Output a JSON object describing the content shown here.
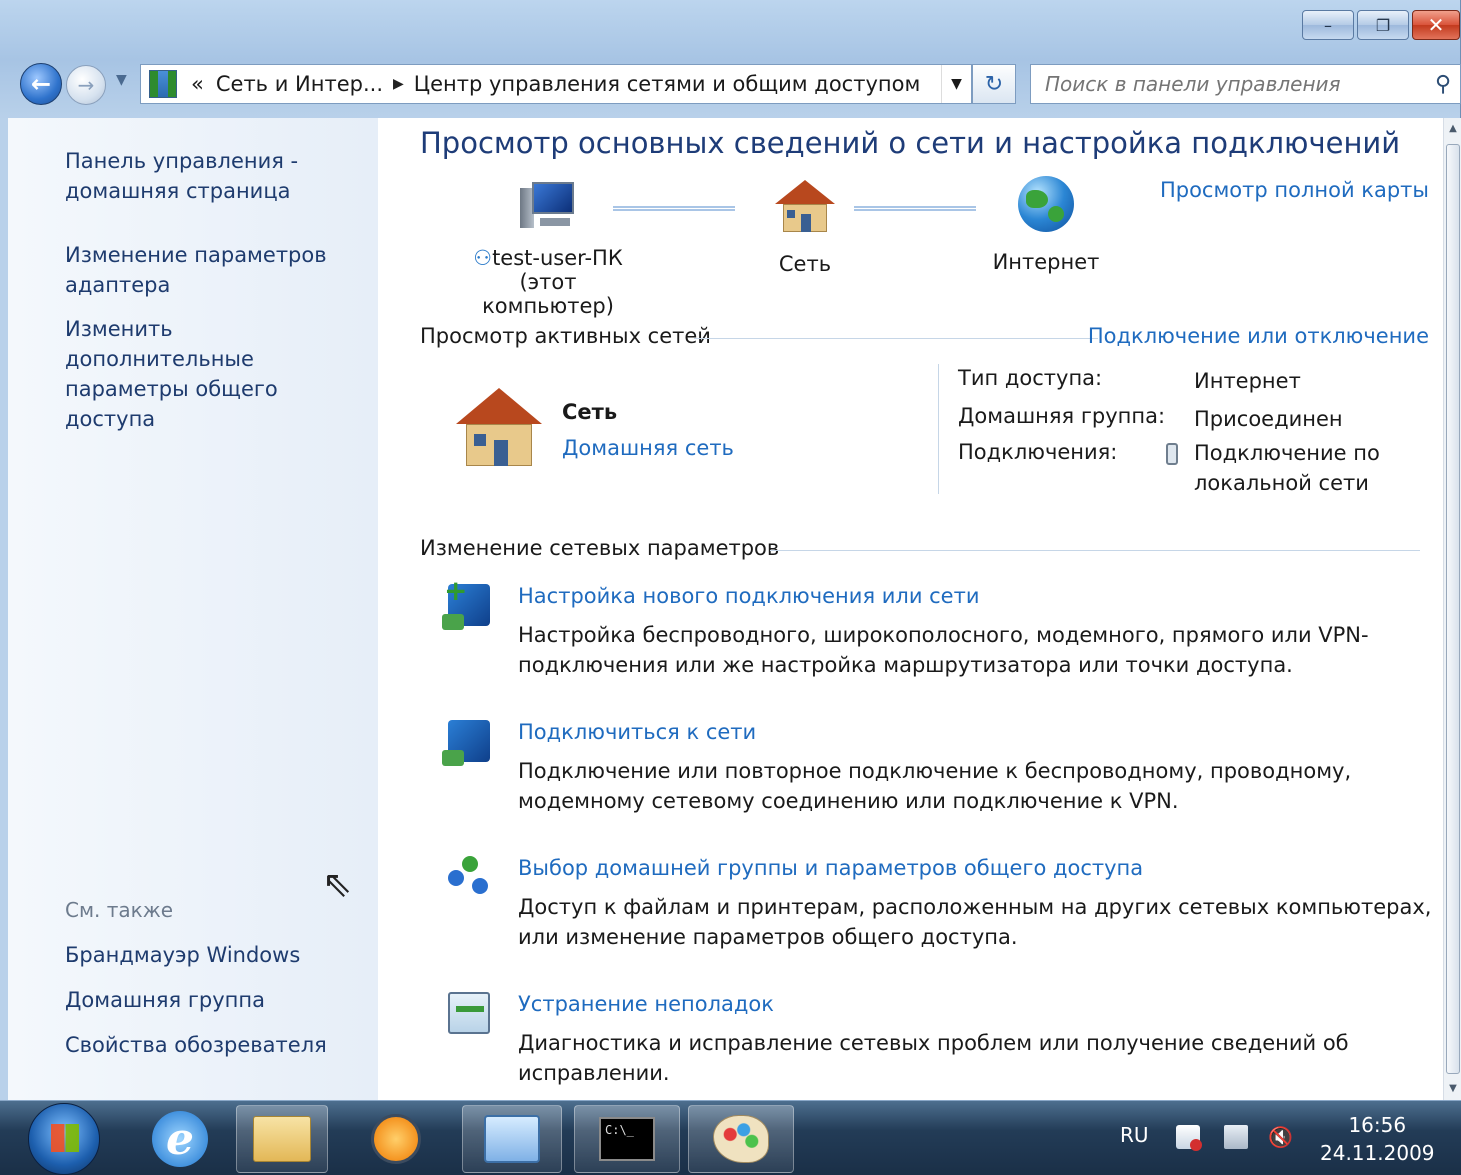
{
  "window": {
    "controls": {
      "minimize": "–",
      "maximize": "❐",
      "close": "✕"
    }
  },
  "nav": {
    "address": {
      "prefix": "«",
      "segment1": "Сеть и Интер...",
      "separator": "▶",
      "segment2": "Центр управления сетями и общим доступом",
      "dropdown": "▼"
    },
    "refresh": "↻",
    "search_placeholder": "Поиск в панели управления",
    "search_icon": "⚲"
  },
  "sidebar": {
    "links": [
      "Панель управления - домашняя страница",
      "Изменение параметров адаптера",
      "Изменить дополнительные параметры общего доступа"
    ],
    "see_also_title": "См. также",
    "see_also": [
      "Брандмауэр Windows",
      "Домашняя группа",
      "Свойства обозревателя"
    ]
  },
  "main": {
    "title": "Просмотр основных сведений о сети и настройка подключений",
    "full_map": "Просмотр полной карты",
    "map": {
      "computer": {
        "name": "test-user-ПК",
        "sub": "(этот компьютер)"
      },
      "network": "Сеть",
      "internet": "Интернет"
    },
    "active_section": {
      "title": "Просмотр активных сетей",
      "action": "Подключение или отключение",
      "network_name": "Сеть",
      "network_type": "Домашняя сеть",
      "access_type_label": "Тип доступа:",
      "access_type_value": "Интернет",
      "homegroup_label": "Домашняя группа:",
      "homegroup_value": "Присоединен",
      "connections_label": "Подключения:",
      "connections_value": "Подключение по локальной сети"
    },
    "change_section": {
      "title": "Изменение сетевых параметров",
      "tasks": [
        {
          "title": "Настройка нового подключения или сети",
          "desc": "Настройка беспроводного, широкополосного, модемного, прямого или VPN-подключения или же настройка маршрутизатора или точки доступа."
        },
        {
          "title": "Подключиться к сети",
          "desc": "Подключение или повторное подключение к беспроводному, проводному, модемному сетевому соединению или подключение к VPN."
        },
        {
          "title": "Выбор домашней группы и параметров общего доступа",
          "desc": "Доступ к файлам и принтерам, расположенным на других сетевых компьютерах, или изменение параметров общего доступа."
        },
        {
          "title": "Устранение неполадок",
          "desc": "Диагностика и исправление сетевых проблем или получение сведений об исправлении."
        }
      ]
    }
  },
  "taskbar": {
    "ie_glyph": "e",
    "cmd_text": "C:\\_",
    "language": "RU",
    "time": "16:56",
    "date": "24.11.2009"
  }
}
